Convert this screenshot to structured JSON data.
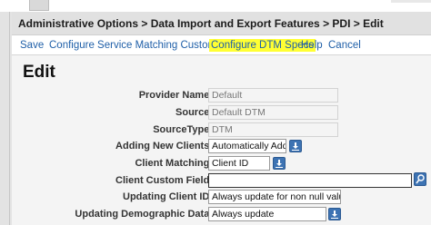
{
  "breadcrumb": "Administrative Options > Data Import and Export Features > PDI > Edit",
  "toolbar": {
    "save": "Save",
    "configure_service_matching": "Configure Service Matching Custom Fields",
    "configure_dtm_specs": "Configure DTM Specs",
    "help": "Help",
    "cancel": "Cancel"
  },
  "page_title": "Edit",
  "form": {
    "provider_name": {
      "label": "Provider Name:",
      "value": "Default"
    },
    "source": {
      "label": "Source:",
      "value": "Default DTM"
    },
    "source_type": {
      "label": "SourceType:",
      "value": "DTM"
    },
    "adding_new_clients": {
      "label": "Adding New Clients:",
      "value": "Automatically Add"
    },
    "client_matching": {
      "label": "Client Matching:",
      "value": "Client ID"
    },
    "client_custom_field": {
      "label": "Client Custom Field:",
      "value": ""
    },
    "updating_client_id": {
      "label": "Updating Client ID:",
      "value": "Always update for non null values"
    },
    "updating_demographic_data": {
      "label": "Updating Demographic Data:",
      "value": "Always update"
    }
  },
  "colors": {
    "link": "#1f5fa8",
    "highlight": "#ffff33",
    "button": "#3d73b3"
  }
}
